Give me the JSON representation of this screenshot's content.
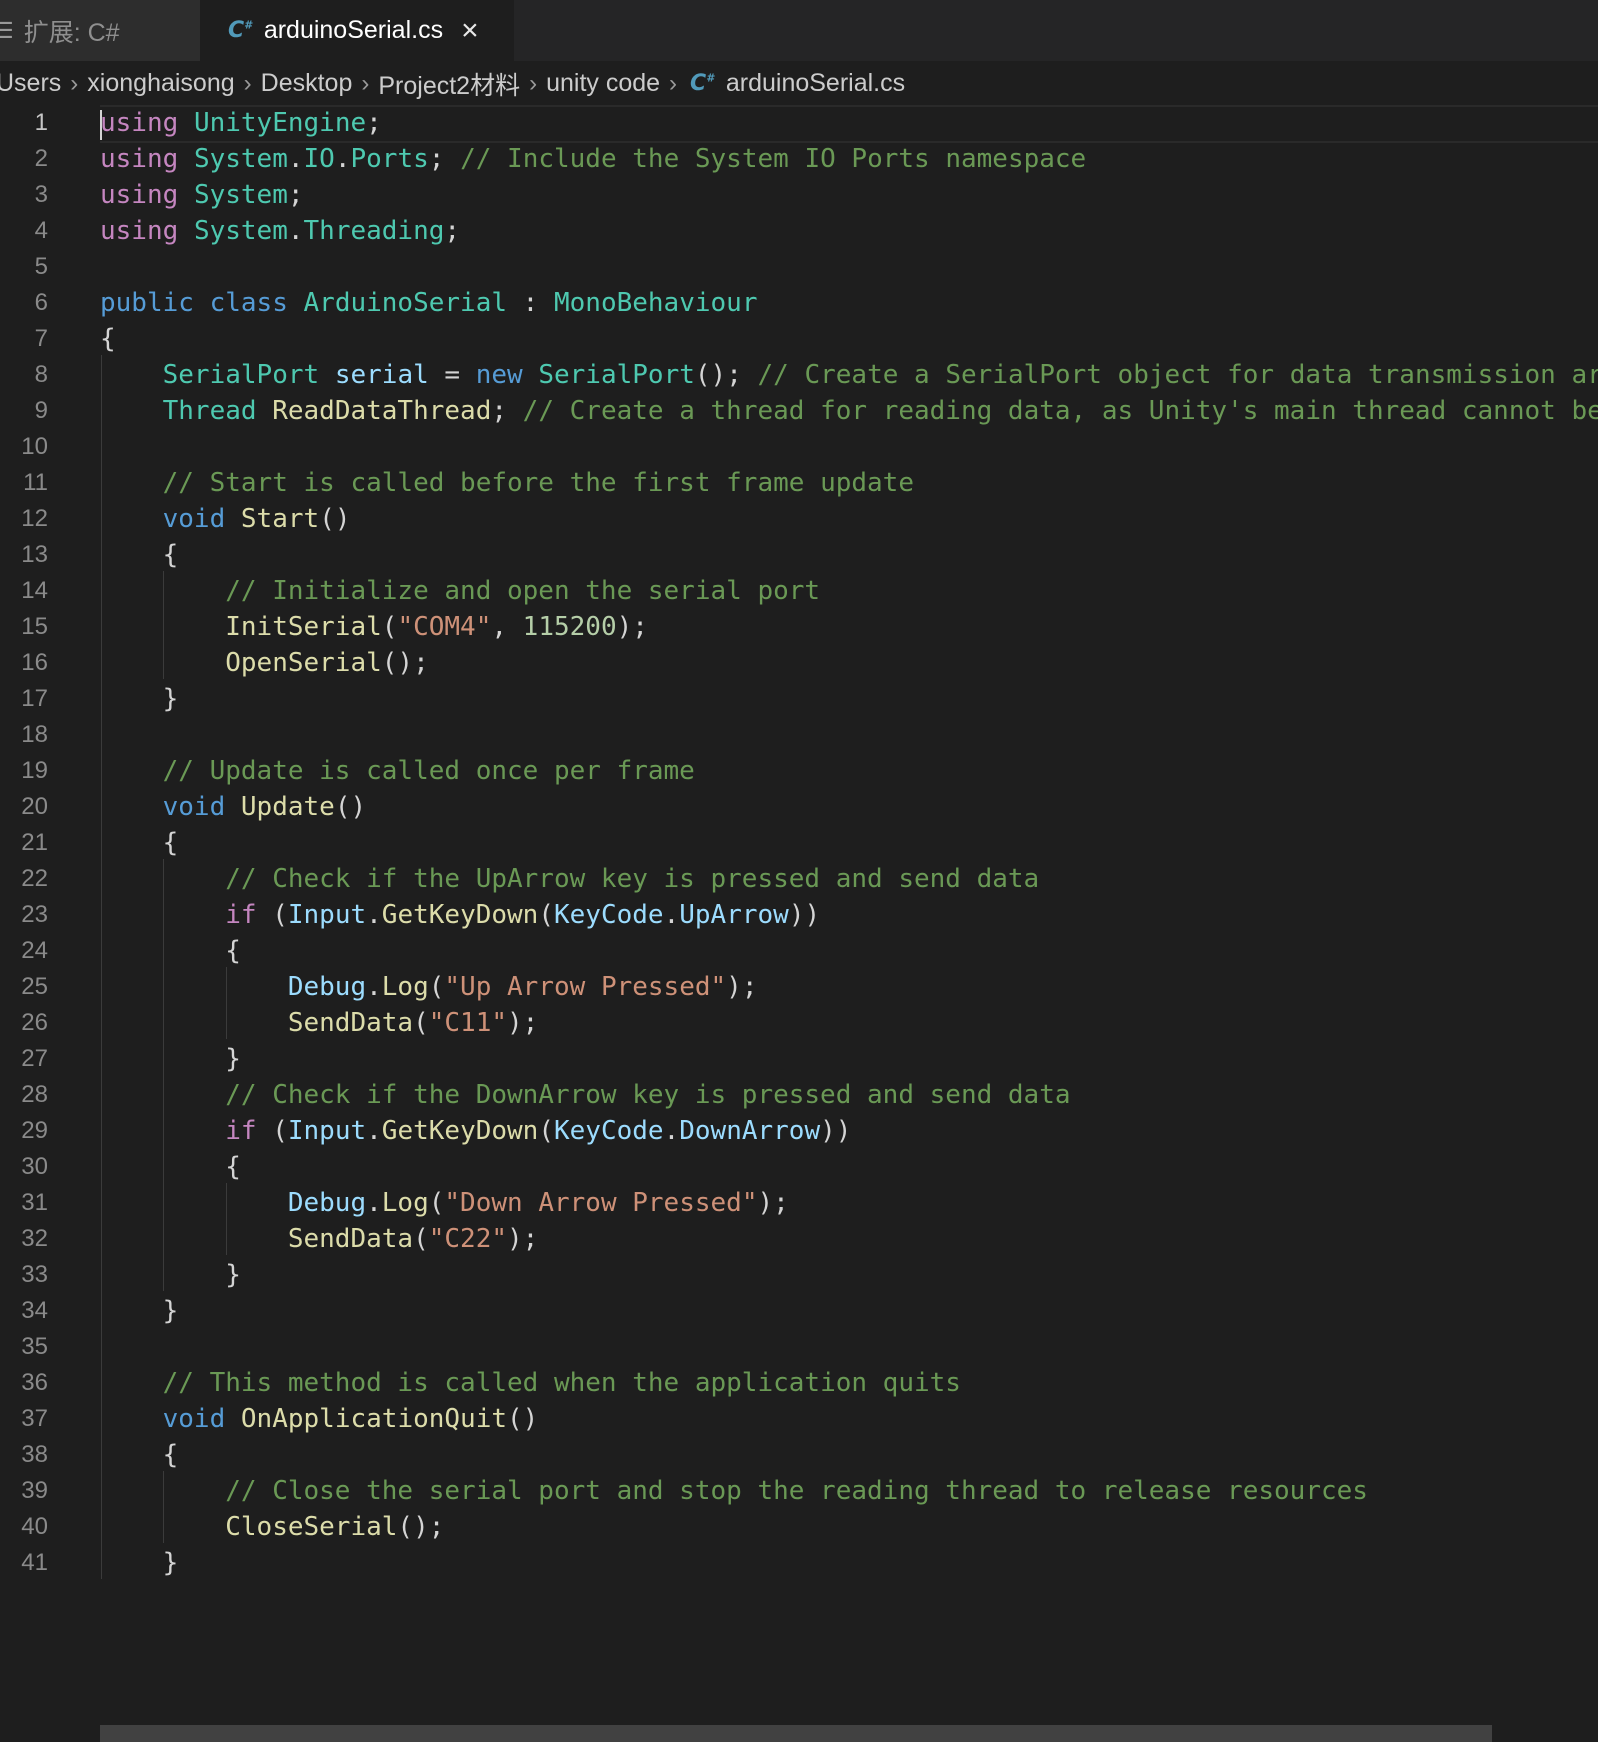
{
  "tabs": [
    {
      "label": "扩展: C#",
      "active": false
    },
    {
      "label": "arduinoSerial.cs",
      "active": true
    }
  ],
  "breadcrumb": [
    "Users",
    "xionghaisong",
    "Desktop",
    "Project2材料",
    "unity code",
    "arduinoSerial.cs"
  ],
  "icons": {
    "tab_menu": "list-icon",
    "file": "csharp-file-icon",
    "close": "close-icon",
    "separator": "chevron-right-icon"
  },
  "colors": {
    "background": "#1e1e1e",
    "tabbar": "#252526",
    "keyword": "#569cd6",
    "control": "#c586c0",
    "type": "#4ec9b0",
    "function": "#dcdcaa",
    "variable": "#9cdcfe",
    "string": "#ce9178",
    "number": "#b5cea8",
    "comment": "#6a9955"
  },
  "editor": {
    "current_line": 1,
    "lines": [
      [
        [
          "ctl",
          "using"
        ],
        [
          "pn",
          " "
        ],
        [
          "ty",
          "UnityEngine"
        ],
        [
          "pn",
          ";"
        ]
      ],
      [
        [
          "ctl",
          "using"
        ],
        [
          "pn",
          " "
        ],
        [
          "ty",
          "System"
        ],
        [
          "pn",
          "."
        ],
        [
          "ty",
          "IO"
        ],
        [
          "pn",
          "."
        ],
        [
          "ty",
          "Ports"
        ],
        [
          "pn",
          "; "
        ],
        [
          "cm",
          "// Include the System IO Ports namespace"
        ]
      ],
      [
        [
          "ctl",
          "using"
        ],
        [
          "pn",
          " "
        ],
        [
          "ty",
          "System"
        ],
        [
          "pn",
          ";"
        ]
      ],
      [
        [
          "ctl",
          "using"
        ],
        [
          "pn",
          " "
        ],
        [
          "ty",
          "System"
        ],
        [
          "pn",
          "."
        ],
        [
          "ty",
          "Threading"
        ],
        [
          "pn",
          ";"
        ]
      ],
      [],
      [
        [
          "kw",
          "public"
        ],
        [
          "pn",
          " "
        ],
        [
          "kw",
          "class"
        ],
        [
          "pn",
          " "
        ],
        [
          "ty",
          "ArduinoSerial"
        ],
        [
          "pn",
          " : "
        ],
        [
          "ty",
          "MonoBehaviour"
        ]
      ],
      [
        [
          "pn",
          "{"
        ]
      ],
      [
        [
          "pn",
          "    "
        ],
        [
          "ty",
          "SerialPort"
        ],
        [
          "pn",
          " "
        ],
        [
          "var",
          "serial"
        ],
        [
          "pn",
          " = "
        ],
        [
          "kw",
          "new"
        ],
        [
          "pn",
          " "
        ],
        [
          "ty",
          "SerialPort"
        ],
        [
          "pn",
          "(); "
        ],
        [
          "cm",
          "// Create a SerialPort object for data transmission ar"
        ]
      ],
      [
        [
          "pn",
          "    "
        ],
        [
          "ty",
          "Thread"
        ],
        [
          "pn",
          " "
        ],
        [
          "fn",
          "ReadDataThread"
        ],
        [
          "pn",
          "; "
        ],
        [
          "cm",
          "// Create a thread for reading data, as Unity's main thread cannot be"
        ]
      ],
      [],
      [
        [
          "pn",
          "    "
        ],
        [
          "cm",
          "// Start is called before the first frame update"
        ]
      ],
      [
        [
          "pn",
          "    "
        ],
        [
          "kw",
          "void"
        ],
        [
          "pn",
          " "
        ],
        [
          "fn",
          "Start"
        ],
        [
          "pn",
          "()"
        ]
      ],
      [
        [
          "pn",
          "    {"
        ]
      ],
      [
        [
          "pn",
          "        "
        ],
        [
          "cm",
          "// Initialize and open the serial port"
        ]
      ],
      [
        [
          "pn",
          "        "
        ],
        [
          "fn",
          "InitSerial"
        ],
        [
          "pn",
          "("
        ],
        [
          "str",
          "\"COM4\""
        ],
        [
          "pn",
          ", "
        ],
        [
          "num",
          "115200"
        ],
        [
          "pn",
          ");"
        ]
      ],
      [
        [
          "pn",
          "        "
        ],
        [
          "fn",
          "OpenSerial"
        ],
        [
          "pn",
          "();"
        ]
      ],
      [
        [
          "pn",
          "    }"
        ]
      ],
      [],
      [
        [
          "pn",
          "    "
        ],
        [
          "cm",
          "// Update is called once per frame"
        ]
      ],
      [
        [
          "pn",
          "    "
        ],
        [
          "kw",
          "void"
        ],
        [
          "pn",
          " "
        ],
        [
          "fn",
          "Update"
        ],
        [
          "pn",
          "()"
        ]
      ],
      [
        [
          "pn",
          "    {"
        ]
      ],
      [
        [
          "pn",
          "        "
        ],
        [
          "cm",
          "// Check if the UpArrow key is pressed and send data"
        ]
      ],
      [
        [
          "pn",
          "        "
        ],
        [
          "ctl",
          "if"
        ],
        [
          "pn",
          " ("
        ],
        [
          "var",
          "Input"
        ],
        [
          "pn",
          "."
        ],
        [
          "fn",
          "GetKeyDown"
        ],
        [
          "pn",
          "("
        ],
        [
          "var",
          "KeyCode"
        ],
        [
          "pn",
          "."
        ],
        [
          "var",
          "UpArrow"
        ],
        [
          "pn",
          "))"
        ]
      ],
      [
        [
          "pn",
          "        {"
        ]
      ],
      [
        [
          "pn",
          "            "
        ],
        [
          "var",
          "Debug"
        ],
        [
          "pn",
          "."
        ],
        [
          "fn",
          "Log"
        ],
        [
          "pn",
          "("
        ],
        [
          "str",
          "\"Up Arrow Pressed\""
        ],
        [
          "pn",
          ");"
        ]
      ],
      [
        [
          "pn",
          "            "
        ],
        [
          "fn",
          "SendData"
        ],
        [
          "pn",
          "("
        ],
        [
          "str",
          "\"C11\""
        ],
        [
          "pn",
          ");"
        ]
      ],
      [
        [
          "pn",
          "        }"
        ]
      ],
      [
        [
          "pn",
          "        "
        ],
        [
          "cm",
          "// Check if the DownArrow key is pressed and send data"
        ]
      ],
      [
        [
          "pn",
          "        "
        ],
        [
          "ctl",
          "if"
        ],
        [
          "pn",
          " ("
        ],
        [
          "var",
          "Input"
        ],
        [
          "pn",
          "."
        ],
        [
          "fn",
          "GetKeyDown"
        ],
        [
          "pn",
          "("
        ],
        [
          "var",
          "KeyCode"
        ],
        [
          "pn",
          "."
        ],
        [
          "var",
          "DownArrow"
        ],
        [
          "pn",
          "))"
        ]
      ],
      [
        [
          "pn",
          "        {"
        ]
      ],
      [
        [
          "pn",
          "            "
        ],
        [
          "var",
          "Debug"
        ],
        [
          "pn",
          "."
        ],
        [
          "fn",
          "Log"
        ],
        [
          "pn",
          "("
        ],
        [
          "str",
          "\"Down Arrow Pressed\""
        ],
        [
          "pn",
          ");"
        ]
      ],
      [
        [
          "pn",
          "            "
        ],
        [
          "fn",
          "SendData"
        ],
        [
          "pn",
          "("
        ],
        [
          "str",
          "\"C22\""
        ],
        [
          "pn",
          ");"
        ]
      ],
      [
        [
          "pn",
          "        }"
        ]
      ],
      [
        [
          "pn",
          "    }"
        ]
      ],
      [],
      [
        [
          "pn",
          "    "
        ],
        [
          "cm",
          "// This method is called when the application quits"
        ]
      ],
      [
        [
          "pn",
          "    "
        ],
        [
          "kw",
          "void"
        ],
        [
          "pn",
          " "
        ],
        [
          "fn",
          "OnApplicationQuit"
        ],
        [
          "pn",
          "()"
        ]
      ],
      [
        [
          "pn",
          "    {"
        ]
      ],
      [
        [
          "pn",
          "        "
        ],
        [
          "cm",
          "// Close the serial port and stop the reading thread to release resources"
        ]
      ],
      [
        [
          "pn",
          "        "
        ],
        [
          "fn",
          "CloseSerial"
        ],
        [
          "pn",
          "();"
        ]
      ],
      [
        [
          "pn",
          "    }"
        ]
      ]
    ]
  }
}
